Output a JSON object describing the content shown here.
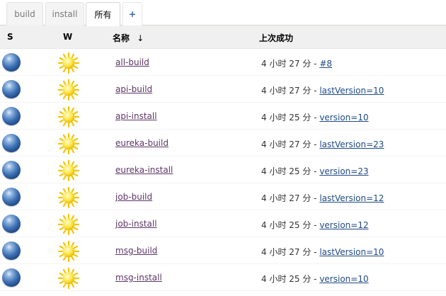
{
  "tabs": [
    {
      "label": "build"
    },
    {
      "label": "install"
    },
    {
      "label": "所有"
    },
    {
      "label": "+"
    }
  ],
  "columns": {
    "status": "S",
    "weather": "W",
    "name": "名称",
    "sort_arrow": "↓",
    "last_success": "上次成功"
  },
  "jobs": [
    {
      "name": "all-build",
      "time": "4 小时 27 分 - ",
      "link": "#8",
      "status_icon": "blue-ball-icon",
      "weather_icon": "sunny-icon"
    },
    {
      "name": "api-build",
      "time": "4 小时 27 分 - ",
      "link": "lastVersion=10",
      "status_icon": "blue-ball-icon",
      "weather_icon": "sunny-icon"
    },
    {
      "name": "api-install",
      "time": "4 小时 25 分 - ",
      "link": "version=10",
      "status_icon": "blue-ball-icon",
      "weather_icon": "sunny-icon"
    },
    {
      "name": "eureka-build",
      "time": "4 小时 27 分 - ",
      "link": "lastVersion=23",
      "status_icon": "blue-ball-icon",
      "weather_icon": "sunny-icon"
    },
    {
      "name": "eureka-install",
      "time": "4 小时 25 分 - ",
      "link": "version=23",
      "status_icon": "blue-ball-icon",
      "weather_icon": "sunny-icon"
    },
    {
      "name": "job-build",
      "time": "4 小时 27 分 - ",
      "link": "lastVersion=12",
      "status_icon": "blue-ball-icon",
      "weather_icon": "sunny-icon"
    },
    {
      "name": "job-install",
      "time": "4 小时 25 分 - ",
      "link": "version=12",
      "status_icon": "blue-ball-icon",
      "weather_icon": "sunny-icon"
    },
    {
      "name": "msg-build",
      "time": "4 小时 27 分 - ",
      "link": "lastVersion=10",
      "status_icon": "blue-ball-icon",
      "weather_icon": "sunny-icon"
    },
    {
      "name": "msg-install",
      "time": "4 小时 25 分 - ",
      "link": "version=10",
      "status_icon": "blue-ball-icon",
      "weather_icon": "sunny-icon"
    }
  ],
  "colors": {
    "link_job": "#5c3566",
    "link_build": "#204a87",
    "status_blue": "#3f72b5",
    "sun_yellow": "#fce94f"
  }
}
